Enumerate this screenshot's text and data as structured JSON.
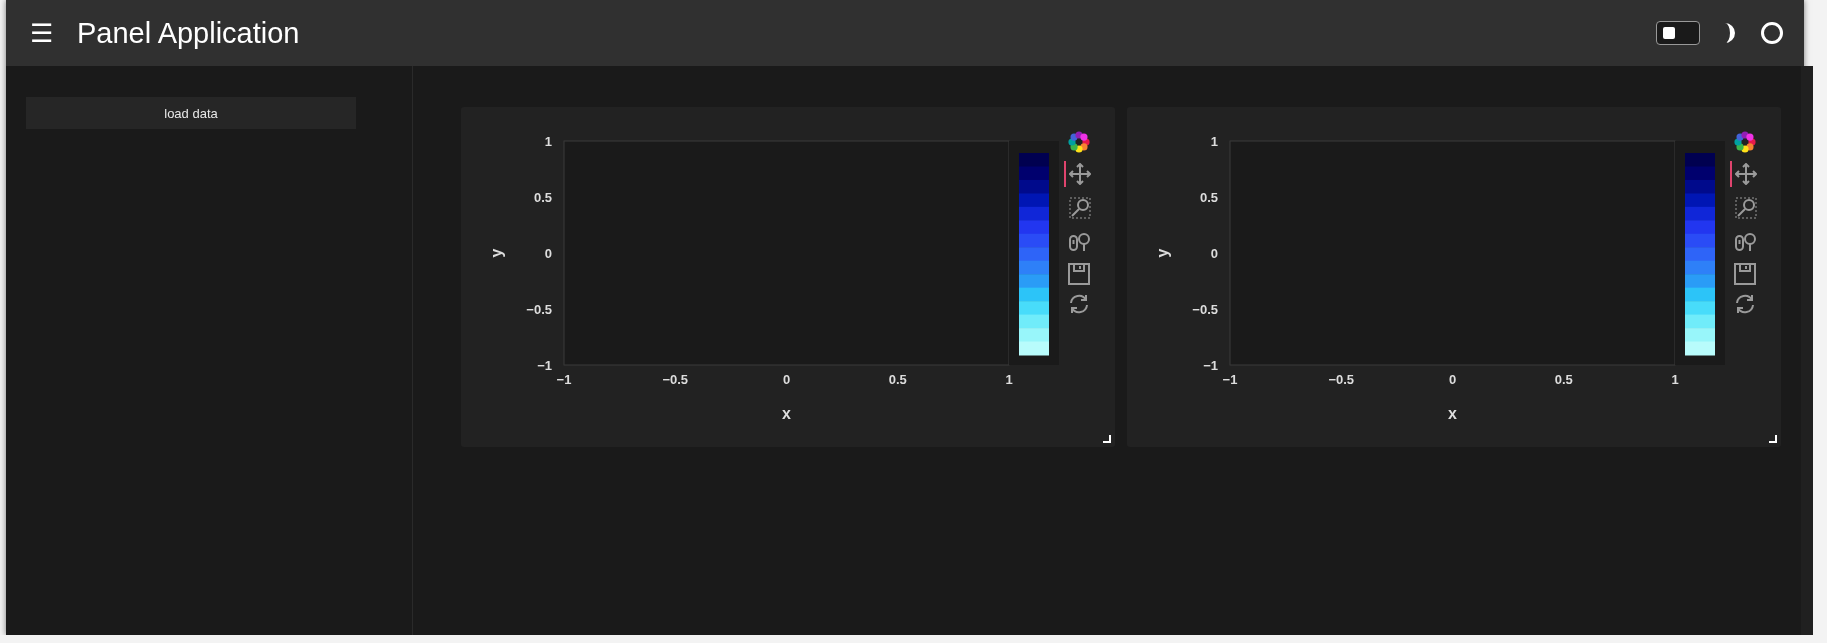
{
  "header": {
    "menu": "☰",
    "title": "Panel Application",
    "switch": {
      "on": false
    }
  },
  "sidebar": {
    "button": "load data"
  },
  "plots": [
    {
      "chart_data": {
        "type": "scatter",
        "xlabel": "x",
        "ylabel": "y",
        "xlim": [
          -1,
          1
        ],
        "ylim": [
          -1,
          1
        ],
        "xticks": [
          -1,
          -0.5,
          0,
          0.5,
          1
        ],
        "yticks": [
          -1,
          -0.5,
          0,
          0.5,
          1
        ]
      },
      "tools": [
        {
          "kind": "logo"
        },
        {
          "kind": "pan",
          "active": true
        },
        {
          "kind": "box_zoom",
          "active": false
        },
        {
          "kind": "wheel_zoom",
          "active": false
        },
        {
          "kind": "save"
        },
        {
          "kind": "reset"
        }
      ]
    },
    {
      "chart_data": {
        "type": "scatter",
        "xlabel": "x",
        "ylabel": "y",
        "xlim": [
          -1,
          1
        ],
        "ylim": [
          -1,
          1
        ],
        "xticks": [
          -1,
          -0.5,
          0,
          0.5,
          1
        ],
        "yticks": [
          -1,
          -0.5,
          0,
          0.5,
          1
        ]
      },
      "tools": [
        {
          "kind": "logo"
        },
        {
          "kind": "pan",
          "active": true
        },
        {
          "kind": "box_zoom",
          "active": false
        },
        {
          "kind": "wheel_zoom",
          "active": false
        },
        {
          "kind": "save"
        },
        {
          "kind": "reset"
        }
      ]
    }
  ]
}
